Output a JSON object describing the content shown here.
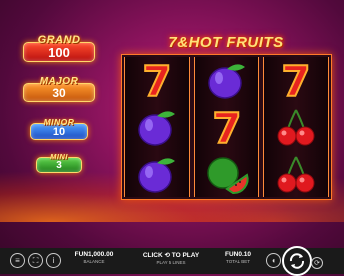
{
  "jackpots": {
    "grand": {
      "label": "GRAND",
      "value": "100"
    },
    "major": {
      "label": "MAJOR",
      "value": "30"
    },
    "minor": {
      "label": "MINOR",
      "value": "10"
    },
    "mini": {
      "label": "MINI",
      "value": "3"
    }
  },
  "logo": {
    "text": "7&HOT FRUITS"
  },
  "reels": [
    [
      "seven",
      "plum",
      "plum"
    ],
    [
      "plum",
      "seven",
      "watermelon"
    ],
    [
      "seven",
      "cherry",
      "cherry"
    ]
  ],
  "bottom_bar": {
    "balance_value": "FUN1,000.00",
    "balance_label": "BALANCE",
    "play_value": "CLICK ⟲ TO PLAY",
    "play_label": "PLAY 5 LINES",
    "total_bet_value": "FUN0.10",
    "total_bet_label": "TOTAL BET",
    "menu_icon": "menu-icon",
    "fullscreen_icon": "fullscreen-icon",
    "info_icon": "info-icon",
    "sound_icon": "sound-icon",
    "spin_icon": "spin-icon",
    "autoplay_icon": "autoplay-icon"
  },
  "colors": {
    "background": "#8a135c",
    "grand": "#d41d1d",
    "major": "#e3701a",
    "minor": "#2f6fe0",
    "mini": "#35a52e",
    "bar": "#1a1a1a"
  }
}
